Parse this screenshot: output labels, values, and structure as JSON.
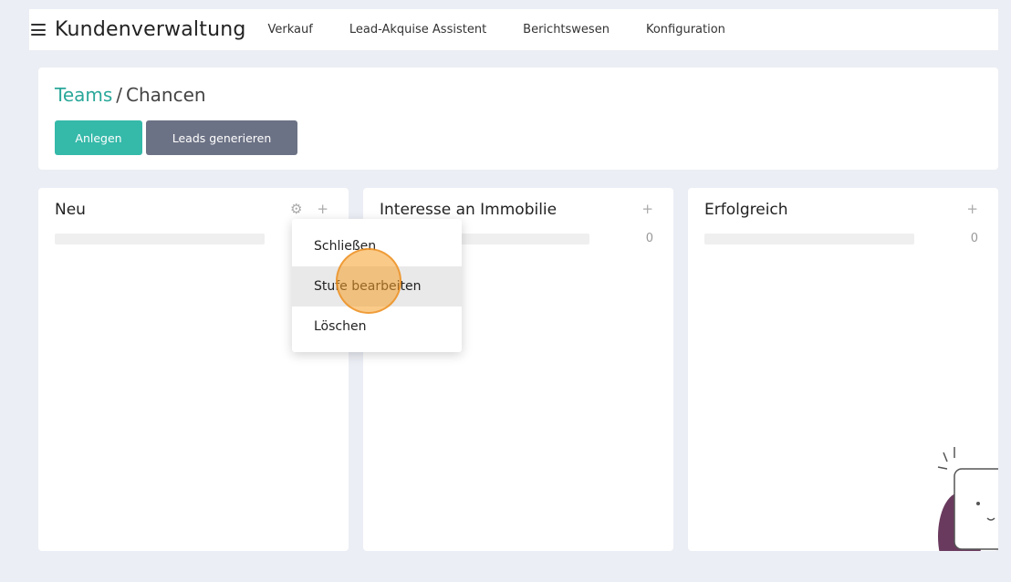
{
  "topbar": {
    "title": "Kundenverwaltung",
    "menu": [
      "Verkauf",
      "Lead-Akquise Assistent",
      "Berichtswesen",
      "Konfiguration"
    ]
  },
  "breadcrumb": {
    "parent": "Teams",
    "separator": "/",
    "current": "Chancen"
  },
  "buttons": {
    "create": "Anlegen",
    "generate": "Leads generieren"
  },
  "columns": [
    {
      "title": "Neu",
      "count": ""
    },
    {
      "title": "Interesse an Immobilie",
      "count": "0"
    },
    {
      "title": "Erfolgreich",
      "count": "0"
    }
  ],
  "dropdown": {
    "items": [
      "Schließen",
      "Stufe bearbeiten",
      "Löschen"
    ]
  },
  "icons": {
    "gear": "gear-icon",
    "plus": "plus-icon",
    "menu": "hamburger-icon"
  },
  "colors": {
    "accent": "#35b9a9",
    "secondary": "#6c7285",
    "highlight": "#f59e28"
  }
}
